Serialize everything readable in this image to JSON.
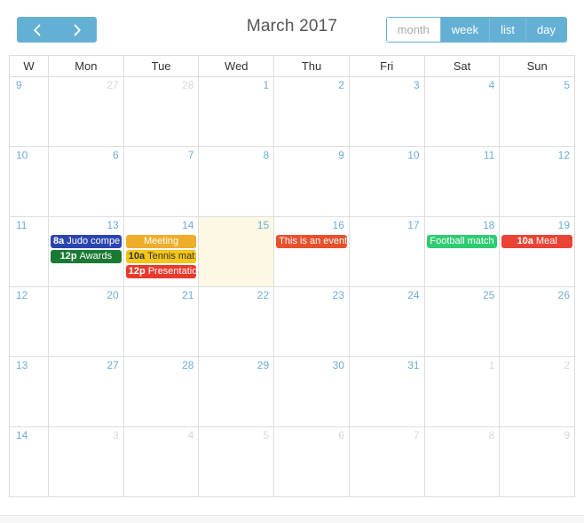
{
  "toolbar": {
    "prev_label": "‹",
    "next_label": "›",
    "title": "March 2017",
    "views": [
      {
        "label": "month",
        "active": true
      },
      {
        "label": "week",
        "active": false
      },
      {
        "label": "list",
        "active": false
      },
      {
        "label": "day",
        "active": false
      }
    ]
  },
  "colors": {
    "accent_blue": "#64b0d4",
    "daynum_blue": "#6eadd8",
    "other_month_gray": "#d8d8d8",
    "today_bg": "#fcf8e3",
    "border": "#dddddd",
    "event_navy": "#2b45b0",
    "event_dark_green": "#1a7a33",
    "event_amber": "#f0ad29",
    "event_yellow": "#f5c518",
    "event_red": "#e8392e",
    "event_orange_red": "#e8502c",
    "event_green": "#2ecc71",
    "event_bright_red": "#ea4335"
  },
  "grid": {
    "week_col_header": "W",
    "day_headers": [
      "Mon",
      "Tue",
      "Wed",
      "Thu",
      "Fri",
      "Sat",
      "Sun"
    ]
  },
  "weeks": [
    {
      "week_number": "9",
      "days": [
        {
          "num": "27",
          "other_month": true,
          "today": false,
          "events": []
        },
        {
          "num": "28",
          "other_month": true,
          "today": false,
          "events": []
        },
        {
          "num": "1",
          "other_month": false,
          "today": false,
          "events": []
        },
        {
          "num": "2",
          "other_month": false,
          "today": false,
          "events": []
        },
        {
          "num": "3",
          "other_month": false,
          "today": false,
          "events": []
        },
        {
          "num": "4",
          "other_month": false,
          "today": false,
          "events": []
        },
        {
          "num": "5",
          "other_month": false,
          "today": false,
          "events": []
        }
      ]
    },
    {
      "week_number": "10",
      "days": [
        {
          "num": "6",
          "other_month": false,
          "today": false,
          "events": []
        },
        {
          "num": "7",
          "other_month": false,
          "today": false,
          "events": []
        },
        {
          "num": "8",
          "other_month": false,
          "today": false,
          "events": []
        },
        {
          "num": "9",
          "other_month": false,
          "today": false,
          "events": []
        },
        {
          "num": "10",
          "other_month": false,
          "today": false,
          "events": []
        },
        {
          "num": "11",
          "other_month": false,
          "today": false,
          "events": []
        },
        {
          "num": "12",
          "other_month": false,
          "today": false,
          "events": []
        }
      ]
    },
    {
      "week_number": "11",
      "days": [
        {
          "num": "13",
          "other_month": false,
          "today": false,
          "events": [
            {
              "time": "8a",
              "title": "Judo compe",
              "bg": "#2b45b0",
              "text": "#ffffff",
              "centered": false
            },
            {
              "time": "12p",
              "title": "Awards",
              "bg": "#1a7a33",
              "text": "#ffffff",
              "centered": true
            }
          ]
        },
        {
          "num": "14",
          "other_month": false,
          "today": false,
          "events": [
            {
              "time": "",
              "title": "Meeting",
              "bg": "#f0ad29",
              "text": "#ffffff",
              "centered": true
            },
            {
              "time": "10a",
              "title": "Tennis mat",
              "bg": "#f5c518",
              "text": "#333333",
              "centered": false
            },
            {
              "time": "12p",
              "title": "Presentatio",
              "bg": "#e8392e",
              "text": "#ffffff",
              "centered": false
            }
          ]
        },
        {
          "num": "15",
          "other_month": false,
          "today": true,
          "events": []
        },
        {
          "num": "16",
          "other_month": false,
          "today": false,
          "events": [
            {
              "time": "",
              "title": "This is an event",
              "bg": "#e8502c",
              "text": "#ffffff",
              "centered": false
            }
          ]
        },
        {
          "num": "17",
          "other_month": false,
          "today": false,
          "events": []
        },
        {
          "num": "18",
          "other_month": false,
          "today": false,
          "events": [
            {
              "time": "",
              "title": "Football match",
              "bg": "#2ecc71",
              "text": "#ffffff",
              "centered": true
            }
          ]
        },
        {
          "num": "19",
          "other_month": false,
          "today": false,
          "events": [
            {
              "time": "10a",
              "title": "Meal",
              "bg": "#ea4335",
              "text": "#ffffff",
              "centered": true
            }
          ]
        }
      ]
    },
    {
      "week_number": "12",
      "days": [
        {
          "num": "20",
          "other_month": false,
          "today": false,
          "events": []
        },
        {
          "num": "21",
          "other_month": false,
          "today": false,
          "events": []
        },
        {
          "num": "22",
          "other_month": false,
          "today": false,
          "events": []
        },
        {
          "num": "23",
          "other_month": false,
          "today": false,
          "events": []
        },
        {
          "num": "24",
          "other_month": false,
          "today": false,
          "events": []
        },
        {
          "num": "25",
          "other_month": false,
          "today": false,
          "events": []
        },
        {
          "num": "26",
          "other_month": false,
          "today": false,
          "events": []
        }
      ]
    },
    {
      "week_number": "13",
      "days": [
        {
          "num": "27",
          "other_month": false,
          "today": false,
          "events": []
        },
        {
          "num": "28",
          "other_month": false,
          "today": false,
          "events": []
        },
        {
          "num": "29",
          "other_month": false,
          "today": false,
          "events": []
        },
        {
          "num": "30",
          "other_month": false,
          "today": false,
          "events": []
        },
        {
          "num": "31",
          "other_month": false,
          "today": false,
          "events": []
        },
        {
          "num": "1",
          "other_month": true,
          "today": false,
          "events": []
        },
        {
          "num": "2",
          "other_month": true,
          "today": false,
          "events": []
        }
      ]
    },
    {
      "week_number": "14",
      "days": [
        {
          "num": "3",
          "other_month": true,
          "today": false,
          "events": []
        },
        {
          "num": "4",
          "other_month": true,
          "today": false,
          "events": []
        },
        {
          "num": "5",
          "other_month": true,
          "today": false,
          "events": []
        },
        {
          "num": "6",
          "other_month": true,
          "today": false,
          "events": []
        },
        {
          "num": "7",
          "other_month": true,
          "today": false,
          "events": []
        },
        {
          "num": "8",
          "other_month": true,
          "today": false,
          "events": []
        },
        {
          "num": "9",
          "other_month": true,
          "today": false,
          "events": []
        }
      ]
    }
  ]
}
